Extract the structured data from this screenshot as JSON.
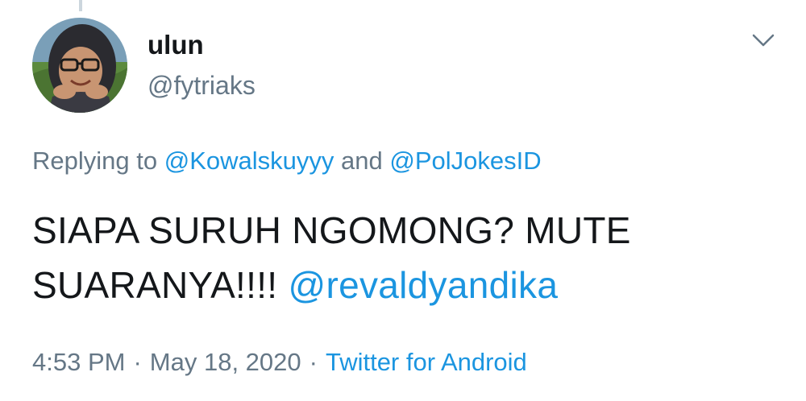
{
  "user": {
    "display_name": "ulun",
    "handle": "@fytriaks"
  },
  "reply": {
    "prefix": "Replying to",
    "mention_1": "@Kowalskuyyy",
    "conjunction": "and",
    "mention_2": "@PolJokesID"
  },
  "tweet": {
    "line_1": "SIAPA SURUH NGOMONG? MUTE",
    "line_2": "SUARANYA!!!!",
    "mention": "@revaldyandika"
  },
  "meta": {
    "time": "4:53 PM",
    "separator": "·",
    "date": "May 18, 2020",
    "source": "Twitter for Android"
  },
  "colors": {
    "text": "#14171a",
    "secondary": "#657786",
    "link": "#1b95e0"
  },
  "icons": {
    "menu": "chevron-down-icon"
  }
}
